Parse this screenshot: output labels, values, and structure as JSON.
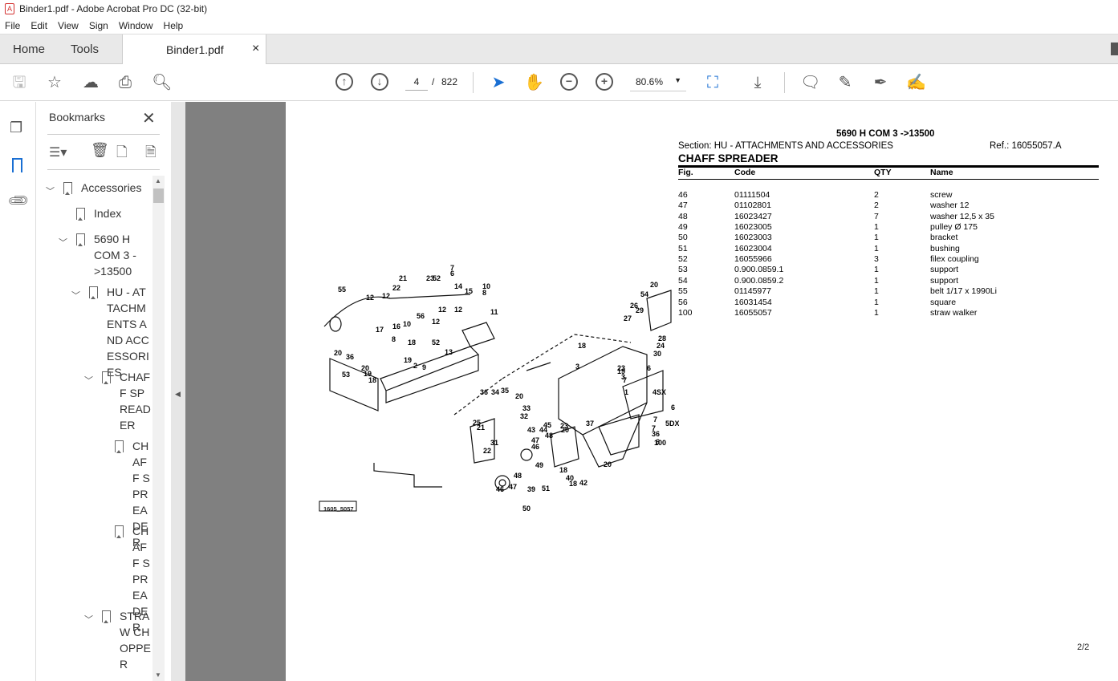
{
  "window": {
    "title": "Binder1.pdf - Adobe Acrobat Pro DC (32-bit)"
  },
  "menu": [
    "File",
    "Edit",
    "View",
    "Sign",
    "Window",
    "Help"
  ],
  "tabs": {
    "home": "Home",
    "tools": "Tools",
    "document": "Binder1.pdf",
    "close": "×"
  },
  "toolbar": {
    "page_current": "4",
    "page_sep": "/",
    "page_total": "822",
    "zoom": "80.6%"
  },
  "bookmarks": {
    "title": "Bookmarks",
    "items": [
      {
        "label": "Accessories",
        "level": 0,
        "expanded": true
      },
      {
        "label": "Index",
        "level": 1
      },
      {
        "label": "5690 H COM 3 ->13500",
        "level": 1,
        "expanded": true
      },
      {
        "label": "HU - ATTACHMENTS AND ACCESSORIES",
        "level": 2,
        "expanded": true
      },
      {
        "label": "CHAFF SPREADER",
        "level": 3,
        "expanded": true
      },
      {
        "label": "CHAFF SPREADER",
        "level": 4
      },
      {
        "label": "CHAFF SPREADER",
        "level": 4
      },
      {
        "label": "STRAW CHOPPER",
        "level": 3,
        "expanded": true
      }
    ]
  },
  "document": {
    "model": "5690 H COM 3 ->13500",
    "section": "Section: HU - ATTACHMENTS AND ACCESSORIES",
    "ref": "Ref.: 16055057.A",
    "title": "CHAFF SPREADER",
    "columns": [
      "Fig.",
      "Code",
      "QTY",
      "Name"
    ],
    "rows": [
      [
        "46",
        "01111504",
        "2",
        "screw"
      ],
      [
        "47",
        "01102801",
        "2",
        "washer 12"
      ],
      [
        "48",
        "16023427",
        "7",
        "washer 12,5 x 35"
      ],
      [
        "49",
        "16023005",
        "1",
        "pulley Ø 175"
      ],
      [
        "50",
        "16023003",
        "1",
        "bracket"
      ],
      [
        "51",
        "16023004",
        "1",
        "bushing"
      ],
      [
        "52",
        "16055966",
        "3",
        "filex coupling"
      ],
      [
        "53",
        "0.900.0859.1",
        "1",
        "support"
      ],
      [
        "54",
        "0.900.0859.2",
        "1",
        "support"
      ],
      [
        "55",
        "01145977",
        "1",
        "belt 1/17 x 1990Li"
      ],
      [
        "56",
        "16031454",
        "1",
        "square"
      ],
      [
        "100",
        "16055057",
        "1",
        "straw walker"
      ]
    ],
    "diagram_id": "1605_5057",
    "callouts": [
      "7",
      "6",
      "23",
      "52",
      "21",
      "22",
      "12",
      "12",
      "55",
      "14",
      "15",
      "10",
      "8",
      "11",
      "56",
      "10",
      "12",
      "12",
      "12",
      "17",
      "16",
      "8",
      "52",
      "13",
      "20",
      "36",
      "53",
      "18",
      "19",
      "2",
      "9",
      "20",
      "19",
      "18",
      "1",
      "3",
      "19",
      "18",
      "3",
      "36",
      "34",
      "35",
      "20",
      "33",
      "32",
      "25",
      "21",
      "22",
      "31",
      "45",
      "43",
      "44",
      "48",
      "47",
      "46",
      "49",
      "48",
      "47",
      "46",
      "50",
      "39",
      "51",
      "18",
      "40",
      "42",
      "18",
      "23",
      "20",
      "37",
      "20",
      "36",
      "20",
      "54",
      "26",
      "27",
      "29",
      "28",
      "24",
      "30",
      "23",
      "7",
      "6",
      "4SX",
      "6",
      "7",
      "5DX",
      "6",
      "7",
      "100"
    ],
    "page_label": "2/2"
  }
}
